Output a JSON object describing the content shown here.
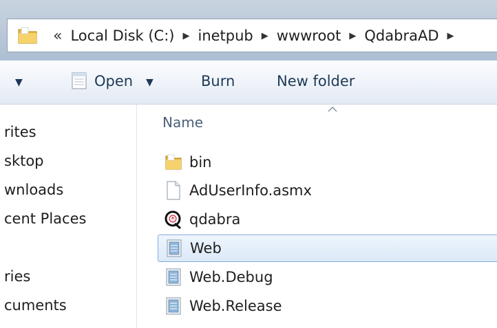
{
  "address_bar": {
    "overflow": "«",
    "breadcrumbs": [
      "Local Disk (C:)",
      "inetpub",
      "wwwroot",
      "QdabraAD"
    ]
  },
  "toolbar": {
    "open_label": "Open",
    "burn_label": "Burn",
    "new_folder_label": "New folder"
  },
  "nav": {
    "items": [
      "rites",
      "sktop",
      "wnloads",
      "cent Places",
      "ries",
      "cuments"
    ]
  },
  "file_list": {
    "column_name": "Name",
    "files": [
      {
        "name": "bin",
        "icon": "folder-icon"
      },
      {
        "name": "AdUserInfo.asmx",
        "icon": "blank-file-icon"
      },
      {
        "name": "qdabra",
        "icon": "qdabra-logo-icon"
      },
      {
        "name": "Web",
        "icon": "config-file-icon",
        "selected": true
      },
      {
        "name": "Web.Debug",
        "icon": "config-file-icon"
      },
      {
        "name": "Web.Release",
        "icon": "config-file-icon"
      }
    ]
  }
}
